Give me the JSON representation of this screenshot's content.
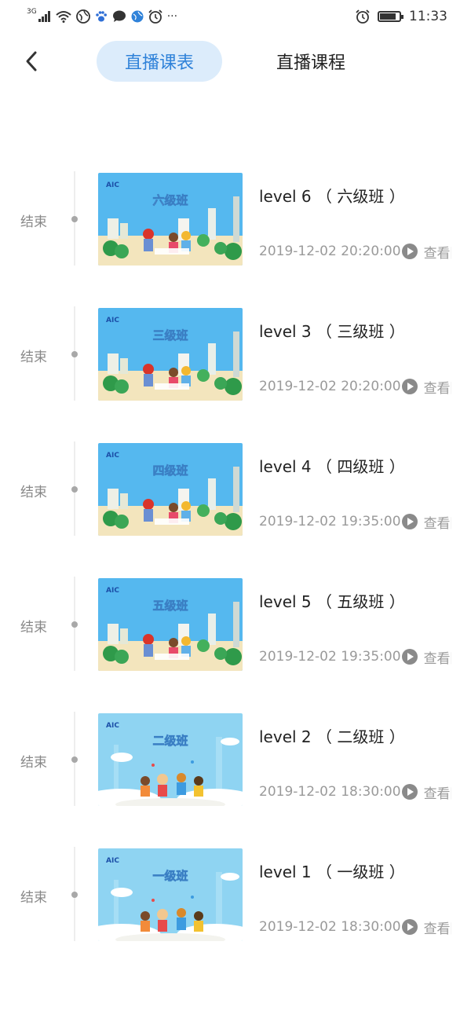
{
  "status_bar": {
    "network": "3G",
    "signal_icon": "signal-icon",
    "more_indicator": "···",
    "time": "11:33",
    "battery_level": 0.85
  },
  "nav": {
    "back_icon": "chevron-left-icon",
    "tab_active": "直播课表",
    "tab_other": "直播课程"
  },
  "accent_color": "#2f82d9",
  "items": [
    {
      "status": "结束",
      "thumb_title": "六级班",
      "thumb_badge": "AIC",
      "title": "level 6 （ 六级班 ）",
      "datetime": "2019-12-02 20:20:00",
      "action": "查看回放",
      "thumb_style": "city"
    },
    {
      "status": "结束",
      "thumb_title": "三级班",
      "thumb_badge": "AIC",
      "title": "level 3 （ 三级班 ）",
      "datetime": "2019-12-02 20:20:00",
      "action": "查看回放",
      "thumb_style": "city"
    },
    {
      "status": "结束",
      "thumb_title": "四级班",
      "thumb_badge": "AIC",
      "title": "level 4 （ 四级班 ）",
      "datetime": "2019-12-02 19:35:00",
      "action": "查看回放",
      "thumb_style": "city"
    },
    {
      "status": "结束",
      "thumb_title": "五级班",
      "thumb_badge": "AIC",
      "title": "level 5 （ 五级班 ）",
      "datetime": "2019-12-02 19:35:00",
      "action": "查看回放",
      "thumb_style": "city"
    },
    {
      "status": "结束",
      "thumb_title": "二级班",
      "thumb_badge": "AIC",
      "title": "level 2 （ 二级班 ）",
      "datetime": "2019-12-02 18:30:00",
      "action": "查看回放",
      "thumb_style": "sky"
    },
    {
      "status": "结束",
      "thumb_title": "一级班",
      "thumb_badge": "AIC",
      "title": "level 1 （ 一级班 ）",
      "datetime": "2019-12-02 18:30:00",
      "action": "查看回放",
      "thumb_style": "sky"
    }
  ]
}
